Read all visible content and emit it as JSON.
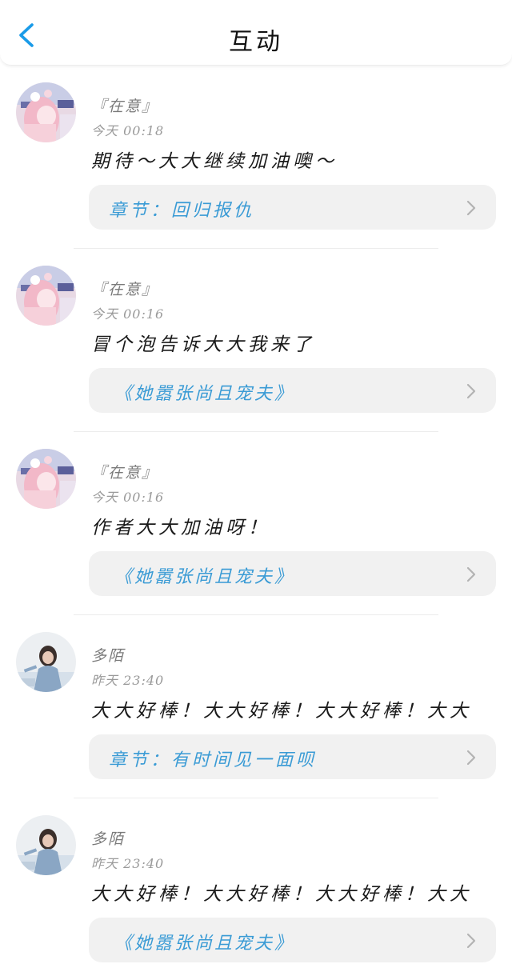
{
  "header": {
    "title": "互动",
    "back_icon": "chevron-left-icon",
    "accent_color": "#1a9be8"
  },
  "comments": [
    {
      "username": "『在意』",
      "time": "今天 00:18",
      "text": "期待～大大继续加油噢～",
      "link": "章节：回归报仇",
      "link_kind": "chapter",
      "avatar": "anime-girl-avatar"
    },
    {
      "username": "『在意』",
      "time": "今天 00:16",
      "text": "冒个泡告诉大大我来了",
      "link": "《她嚣张尚且宠夫》",
      "link_kind": "book",
      "avatar": "anime-girl-avatar"
    },
    {
      "username": "『在意』",
      "time": "今天 00:16",
      "text": "作者大大加油呀！",
      "link": "《她嚣张尚且宠夫》",
      "link_kind": "book",
      "avatar": "anime-girl-avatar"
    },
    {
      "username": "多陌",
      "time": "昨天 23:40",
      "text": "大大好棒！大大好棒！大大好棒！大大",
      "link": "章节：有时间见一面呗",
      "link_kind": "chapter",
      "avatar": "photo-girl-avatar"
    },
    {
      "username": "多陌",
      "time": "昨天 23:40",
      "text": "大大好棒！大大好棒！大大好棒！大大",
      "link": "《她嚣张尚且宠夫》",
      "link_kind": "book",
      "avatar": "photo-girl-avatar"
    }
  ],
  "colors": {
    "link_text": "#3a9bd5",
    "card_bg": "#f1f1f1",
    "meta_text": "#9a9a9a"
  }
}
